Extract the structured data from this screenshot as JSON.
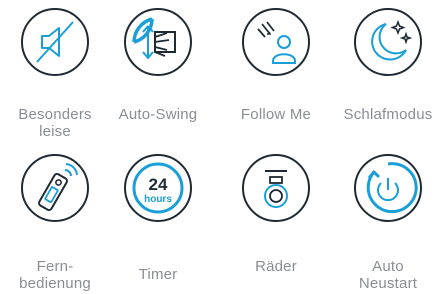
{
  "colors": {
    "dark": "#1f2a33",
    "accent": "#1a9fd8",
    "label": "#8a8e93"
  },
  "features": [
    {
      "icon": "speaker-muted-icon",
      "label_line1": "Besonders",
      "label_line2": "leise"
    },
    {
      "icon": "auto-swing-icon",
      "label_line1": "Auto-Swing",
      "label_line2": ""
    },
    {
      "icon": "follow-me-icon",
      "label_line1": "Follow Me",
      "label_line2": ""
    },
    {
      "icon": "moon-stars-icon",
      "label_line1": "Schlafmodus",
      "label_line2": ""
    },
    {
      "icon": "remote-control-icon",
      "label_line1": "Fern-",
      "label_line2": "bedienung"
    },
    {
      "icon": "timer-icon",
      "label_line1": "Timer",
      "label_line2": "",
      "timer_value": "24",
      "timer_unit": "hours"
    },
    {
      "icon": "wheels-icon",
      "label_line1": "Räder",
      "label_line2": ""
    },
    {
      "icon": "power-icon",
      "label_line1": "Auto",
      "label_line2": "Neustart"
    }
  ]
}
